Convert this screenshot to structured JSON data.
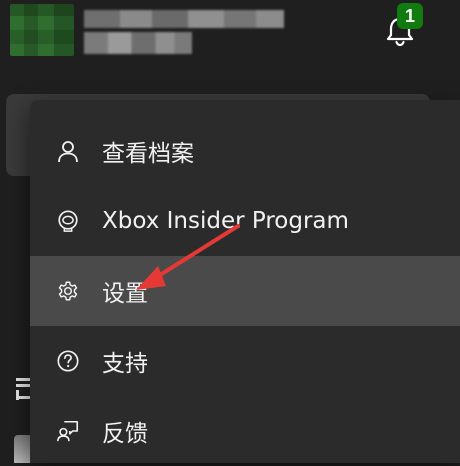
{
  "header": {
    "notification_count": "1",
    "accent_color": "#107c10"
  },
  "menu": {
    "items": [
      {
        "label": "查看档案",
        "icon": "person-icon"
      },
      {
        "label": "Xbox Insider Program",
        "icon": "xbox-insider-icon"
      },
      {
        "label": "设置",
        "icon": "gear-icon",
        "state": "highlighted"
      },
      {
        "label": "支持",
        "icon": "help-circle-icon"
      },
      {
        "label": "反馈",
        "icon": "feedback-icon"
      }
    ]
  },
  "annotation": {
    "arrow_color": "#e53935"
  }
}
